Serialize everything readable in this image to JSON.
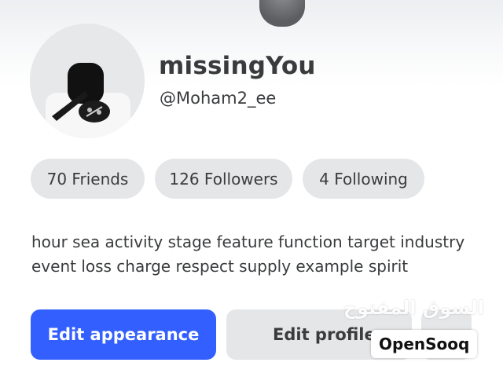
{
  "profile": {
    "display_name": "missingYou",
    "username": "@Moham2_ee"
  },
  "stats": {
    "friends": "70 Friends",
    "followers": "126 Followers",
    "following": "4 Following"
  },
  "bio": {
    "line1": "hour sea activity stage feature function target industry",
    "line2": "event loss charge respect supply example spirit"
  },
  "actions": {
    "edit_appearance": "Edit appearance",
    "edit_profile": "Edit profile",
    "more_label": "…"
  },
  "watermark": {
    "arabic": "السوق المفتوح",
    "brand": "OpenSooq"
  },
  "colors": {
    "primary_button": "#335fff",
    "pill_background": "#e5e6e8",
    "text": "#393b3d"
  },
  "icons": {
    "avatar": "user-avatar-icon",
    "banner_avatar": "banner-avatar-icon"
  }
}
